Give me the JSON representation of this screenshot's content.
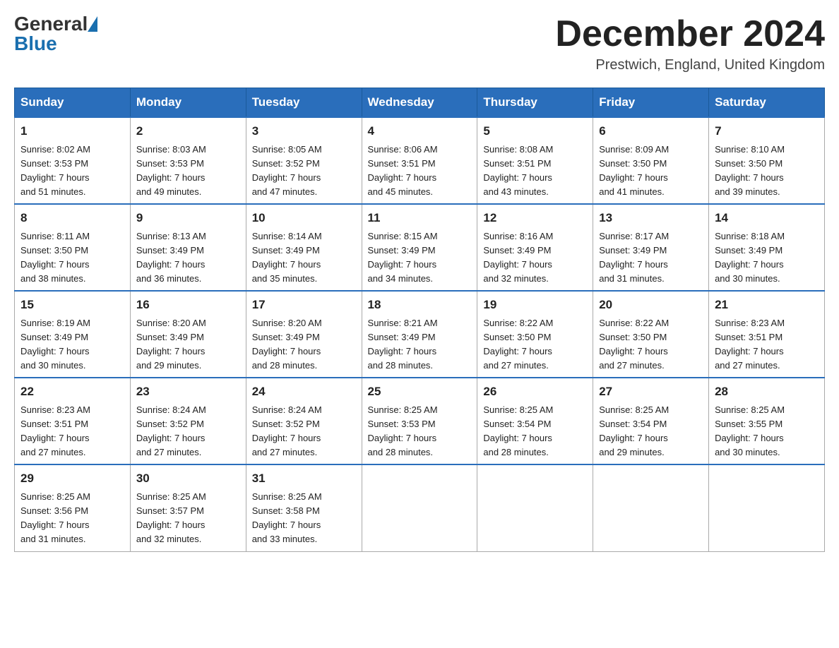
{
  "header": {
    "logo_general": "General",
    "logo_blue": "Blue",
    "month_title": "December 2024",
    "location": "Prestwich, England, United Kingdom"
  },
  "days_of_week": [
    "Sunday",
    "Monday",
    "Tuesday",
    "Wednesday",
    "Thursday",
    "Friday",
    "Saturday"
  ],
  "weeks": [
    [
      {
        "day": "1",
        "sunrise": "8:02 AM",
        "sunset": "3:53 PM",
        "daylight": "7 hours and 51 minutes."
      },
      {
        "day": "2",
        "sunrise": "8:03 AM",
        "sunset": "3:53 PM",
        "daylight": "7 hours and 49 minutes."
      },
      {
        "day": "3",
        "sunrise": "8:05 AM",
        "sunset": "3:52 PM",
        "daylight": "7 hours and 47 minutes."
      },
      {
        "day": "4",
        "sunrise": "8:06 AM",
        "sunset": "3:51 PM",
        "daylight": "7 hours and 45 minutes."
      },
      {
        "day": "5",
        "sunrise": "8:08 AM",
        "sunset": "3:51 PM",
        "daylight": "7 hours and 43 minutes."
      },
      {
        "day": "6",
        "sunrise": "8:09 AM",
        "sunset": "3:50 PM",
        "daylight": "7 hours and 41 minutes."
      },
      {
        "day": "7",
        "sunrise": "8:10 AM",
        "sunset": "3:50 PM",
        "daylight": "7 hours and 39 minutes."
      }
    ],
    [
      {
        "day": "8",
        "sunrise": "8:11 AM",
        "sunset": "3:50 PM",
        "daylight": "7 hours and 38 minutes."
      },
      {
        "day": "9",
        "sunrise": "8:13 AM",
        "sunset": "3:49 PM",
        "daylight": "7 hours and 36 minutes."
      },
      {
        "day": "10",
        "sunrise": "8:14 AM",
        "sunset": "3:49 PM",
        "daylight": "7 hours and 35 minutes."
      },
      {
        "day": "11",
        "sunrise": "8:15 AM",
        "sunset": "3:49 PM",
        "daylight": "7 hours and 34 minutes."
      },
      {
        "day": "12",
        "sunrise": "8:16 AM",
        "sunset": "3:49 PM",
        "daylight": "7 hours and 32 minutes."
      },
      {
        "day": "13",
        "sunrise": "8:17 AM",
        "sunset": "3:49 PM",
        "daylight": "7 hours and 31 minutes."
      },
      {
        "day": "14",
        "sunrise": "8:18 AM",
        "sunset": "3:49 PM",
        "daylight": "7 hours and 30 minutes."
      }
    ],
    [
      {
        "day": "15",
        "sunrise": "8:19 AM",
        "sunset": "3:49 PM",
        "daylight": "7 hours and 30 minutes."
      },
      {
        "day": "16",
        "sunrise": "8:20 AM",
        "sunset": "3:49 PM",
        "daylight": "7 hours and 29 minutes."
      },
      {
        "day": "17",
        "sunrise": "8:20 AM",
        "sunset": "3:49 PM",
        "daylight": "7 hours and 28 minutes."
      },
      {
        "day": "18",
        "sunrise": "8:21 AM",
        "sunset": "3:49 PM",
        "daylight": "7 hours and 28 minutes."
      },
      {
        "day": "19",
        "sunrise": "8:22 AM",
        "sunset": "3:50 PM",
        "daylight": "7 hours and 27 minutes."
      },
      {
        "day": "20",
        "sunrise": "8:22 AM",
        "sunset": "3:50 PM",
        "daylight": "7 hours and 27 minutes."
      },
      {
        "day": "21",
        "sunrise": "8:23 AM",
        "sunset": "3:51 PM",
        "daylight": "7 hours and 27 minutes."
      }
    ],
    [
      {
        "day": "22",
        "sunrise": "8:23 AM",
        "sunset": "3:51 PM",
        "daylight": "7 hours and 27 minutes."
      },
      {
        "day": "23",
        "sunrise": "8:24 AM",
        "sunset": "3:52 PM",
        "daylight": "7 hours and 27 minutes."
      },
      {
        "day": "24",
        "sunrise": "8:24 AM",
        "sunset": "3:52 PM",
        "daylight": "7 hours and 27 minutes."
      },
      {
        "day": "25",
        "sunrise": "8:25 AM",
        "sunset": "3:53 PM",
        "daylight": "7 hours and 28 minutes."
      },
      {
        "day": "26",
        "sunrise": "8:25 AM",
        "sunset": "3:54 PM",
        "daylight": "7 hours and 28 minutes."
      },
      {
        "day": "27",
        "sunrise": "8:25 AM",
        "sunset": "3:54 PM",
        "daylight": "7 hours and 29 minutes."
      },
      {
        "day": "28",
        "sunrise": "8:25 AM",
        "sunset": "3:55 PM",
        "daylight": "7 hours and 30 minutes."
      }
    ],
    [
      {
        "day": "29",
        "sunrise": "8:25 AM",
        "sunset": "3:56 PM",
        "daylight": "7 hours and 31 minutes."
      },
      {
        "day": "30",
        "sunrise": "8:25 AM",
        "sunset": "3:57 PM",
        "daylight": "7 hours and 32 minutes."
      },
      {
        "day": "31",
        "sunrise": "8:25 AM",
        "sunset": "3:58 PM",
        "daylight": "7 hours and 33 minutes."
      },
      null,
      null,
      null,
      null
    ]
  ],
  "labels": {
    "sunrise": "Sunrise:",
    "sunset": "Sunset:",
    "daylight": "Daylight:"
  }
}
